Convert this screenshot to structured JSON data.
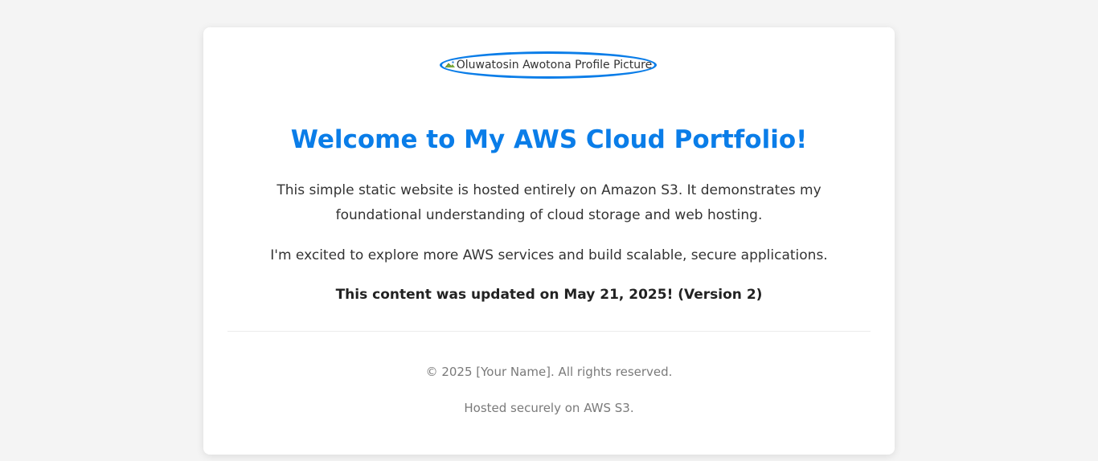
{
  "header": {
    "profile_image_alt": "Oluwatosin Awotona Profile Picture"
  },
  "main": {
    "title": "Welcome to My AWS Cloud Portfolio!",
    "paragraph_1": "This simple static website is hosted entirely on Amazon S3. It demonstrates my foundational understanding of cloud storage and web hosting.",
    "paragraph_2": "I'm excited to explore more AWS services and build scalable, secure applications.",
    "update_note": "This content was updated on May 21, 2025! (Version 2)"
  },
  "footer": {
    "copyright": "© 2025 [Your Name]. All rights reserved.",
    "hosting": "Hosted securely on AWS S3."
  },
  "colors": {
    "accent": "#0a7de8",
    "background": "#f4f4f4",
    "card": "#ffffff"
  }
}
